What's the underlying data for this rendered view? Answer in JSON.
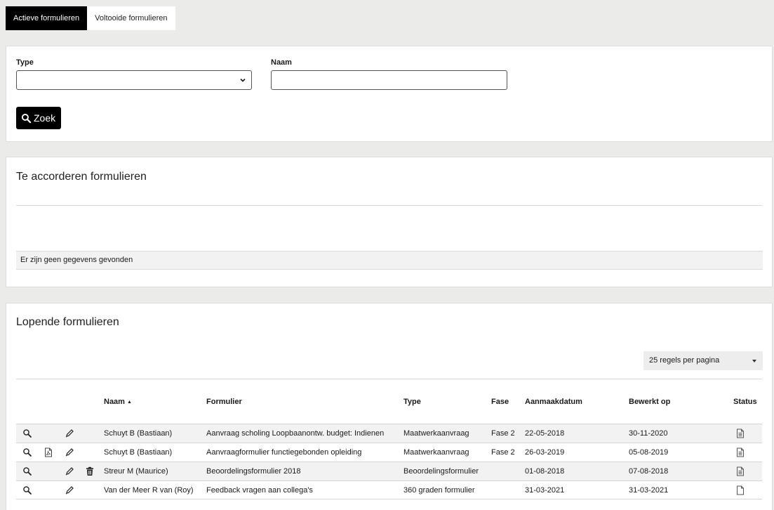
{
  "tabs": [
    {
      "label": "Actieve formulieren",
      "active": true
    },
    {
      "label": "Voltooide formulieren",
      "active": false
    }
  ],
  "search": {
    "type_label": "Type",
    "type_value": "",
    "name_label": "Naam",
    "name_value": "",
    "button_label": "Zoek",
    "button_icon": "search-icon"
  },
  "approve": {
    "title": "Te accorderen formulieren",
    "empty_message": "Er zijn geen gegevens gevonden"
  },
  "running": {
    "title": "Lopende formulieren",
    "page_size_label": "25 regels per pagina",
    "columns": {
      "name": "Naam",
      "form": "Formulier",
      "type": "Type",
      "phase": "Fase",
      "created": "Aanmaakdatum",
      "edited": "Bewerkt op",
      "status": "Status"
    },
    "sort_indicator": "▲",
    "rows": [
      {
        "name": "Schuyt B (Bastiaan)",
        "form": "Aanvraag scholing Loopbaanontw. budget: Indienen",
        "type": "Maatwerkaanvraag",
        "phase": "Fase 2",
        "created": "22-05-2018",
        "edited": "30-11-2020",
        "has_pdf": false,
        "has_delete": false,
        "status_icon": "document-lines-icon"
      },
      {
        "name": "Schuyt B (Bastiaan)",
        "form": "Aanvraagformulier functiegebonden opleiding",
        "type": "Maatwerkaanvraag",
        "phase": "Fase 2",
        "created": "26-03-2019",
        "edited": "05-08-2019",
        "has_pdf": true,
        "has_delete": false,
        "status_icon": "document-lines-icon"
      },
      {
        "name": "Streur M (Maurice)",
        "form": "Beoordelingsformulier 2018",
        "type": "Beoordelingsformulier",
        "phase": "",
        "created": "01-08-2018",
        "edited": "07-08-2018",
        "has_pdf": false,
        "has_delete": true,
        "status_icon": "document-lines-icon"
      },
      {
        "name": "Van der Meer R van (Roy)",
        "form": "Feedback vragen aan collega's",
        "type": "360 graden formulier",
        "phase": "",
        "created": "31-03-2021",
        "edited": "31-03-2021",
        "has_pdf": false,
        "has_delete": false,
        "status_icon": "document-blank-icon"
      }
    ]
  },
  "colors": {
    "page_bg": "#ebebea",
    "active_tab_bg": "#000000",
    "button_bg": "#000000",
    "row_stripe": "#f2f2f2"
  }
}
